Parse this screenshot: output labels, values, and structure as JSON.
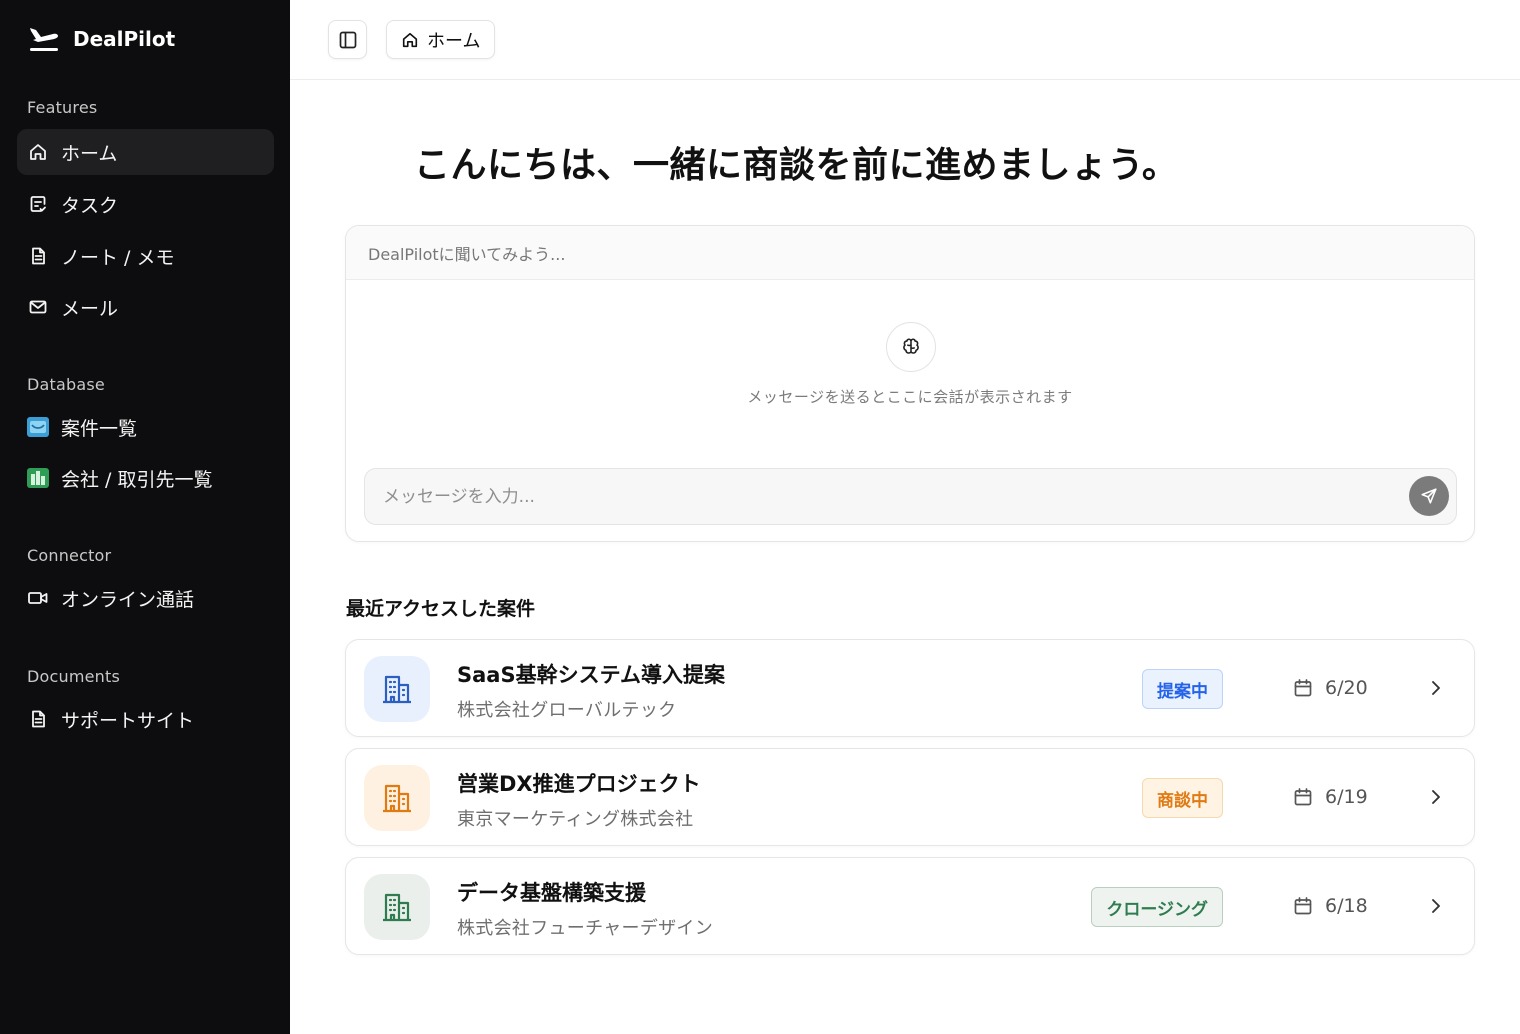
{
  "brand": {
    "name": "DealPilot"
  },
  "sidebar": {
    "sections": [
      {
        "label": "Features"
      },
      {
        "label": "Database"
      },
      {
        "label": "Connector"
      },
      {
        "label": "Documents"
      }
    ],
    "items": [
      {
        "label": "ホーム",
        "icon": "home-icon",
        "active": true
      },
      {
        "label": "タスク",
        "icon": "task-icon"
      },
      {
        "label": "ノート / メモ",
        "icon": "note-icon"
      },
      {
        "label": "メール",
        "icon": "mail-icon"
      },
      {
        "label": "案件一覧",
        "icon": "deals-db-icon"
      },
      {
        "label": "会社 / 取引先一覧",
        "icon": "company-db-icon"
      },
      {
        "label": "オンライン通話",
        "icon": "video-icon"
      },
      {
        "label": "サポートサイト",
        "icon": "document-icon"
      }
    ]
  },
  "topbar": {
    "breadcrumb": "ホーム"
  },
  "main": {
    "greeting": "こんにちは、一緒に商談を前に進めましょう。",
    "chat": {
      "header": "DealPilotに聞いてみよう...",
      "empty_text": "メッセージを送るとここに会話が表示されます",
      "input_placeholder": "メッセージを入力..."
    },
    "recent_title": "最近アクセスした案件",
    "deals": [
      {
        "title": "SaaS基幹システム導入提案",
        "company": "株式会社グローバルテック",
        "status": "提案中",
        "date": "6/20",
        "status_color": "#2563eb",
        "status_bg": "#eaf2fe",
        "status_border": "#bcd3f7",
        "avatar_bg": "#e9f0fd",
        "icon_color": "#2b5fc2"
      },
      {
        "title": "営業DX推進プロジェクト",
        "company": "東京マーケティング株式会社",
        "status": "商談中",
        "date": "6/19",
        "status_color": "#e07a12",
        "status_bg": "#fff3e3",
        "status_border": "#f7d9b0",
        "avatar_bg": "#fff1e1",
        "icon_color": "#e07a12"
      },
      {
        "title": "データ基盤構築支援",
        "company": "株式会社フューチャーデザイン",
        "status": "クロージング",
        "date": "6/18",
        "status_color": "#2f7d4f",
        "status_bg": "#eef3ef",
        "status_border": "#b9cfc0",
        "avatar_bg": "#eaefeb",
        "icon_color": "#2f7d4f"
      }
    ]
  }
}
